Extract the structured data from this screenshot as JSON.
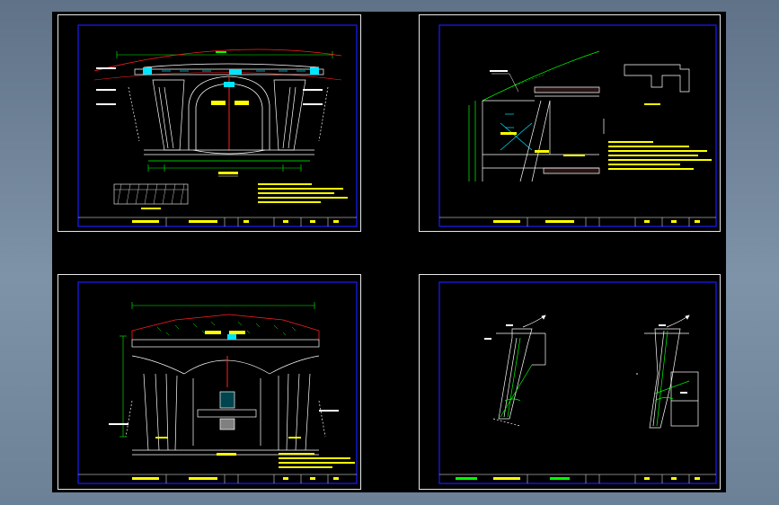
{
  "colors": {
    "background": "#6d8197",
    "canvas": "#000000",
    "frame": "#1a1aff",
    "drawing_line": "#ffffff",
    "accent_red": "#ff2020",
    "annotation": "#ffff00",
    "dimension": "#00ff00",
    "highlight": "#00e5ff"
  },
  "sheets": [
    {
      "id": "sheet-1"
    },
    {
      "id": "sheet-2"
    },
    {
      "id": "sheet-3"
    },
    {
      "id": "sheet-4"
    }
  ]
}
